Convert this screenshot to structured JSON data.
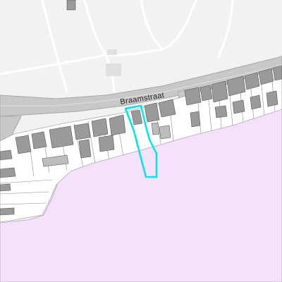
{
  "map": {
    "street_name": "Braamstraat",
    "colors": {
      "background": "#f2f2f2",
      "zone": "#f4e1fb",
      "road": "#c8c8c8",
      "road_edge": "#a8a8a8",
      "path": "#ffffff",
      "building": "#9a9a9a",
      "building_outline": "#555555",
      "lot": "#ffffff",
      "highlight": "#00e5ee"
    },
    "highlighted_parcel": {
      "outline_color": "#00e5ee"
    }
  }
}
